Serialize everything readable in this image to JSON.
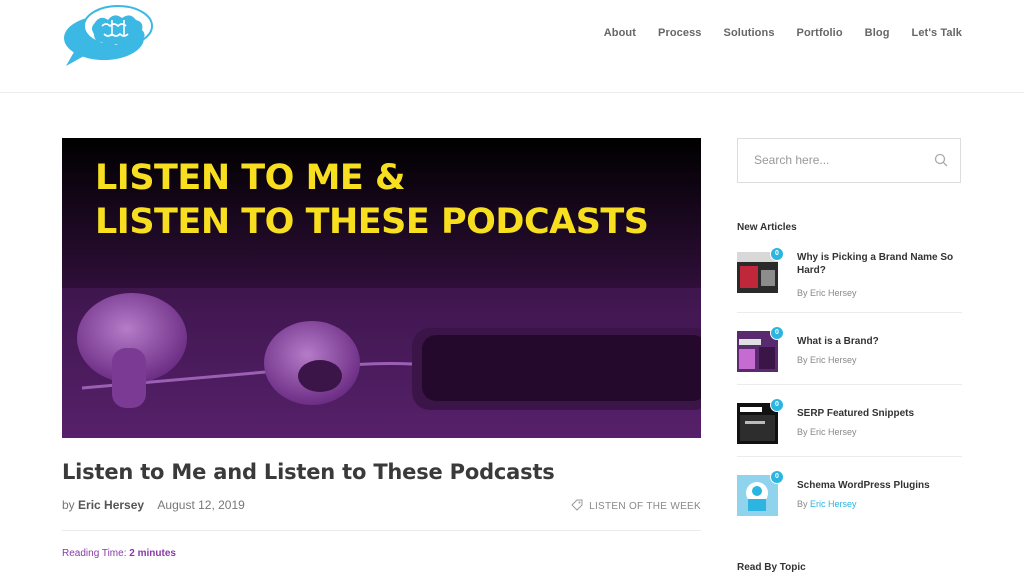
{
  "nav": {
    "items": [
      "About",
      "Process",
      "Solutions",
      "Portfolio",
      "Blog",
      "Let's Talk"
    ]
  },
  "hero": {
    "line1": "LISTEN TO ME &",
    "line2": "LISTEN TO THESE PODCASTS"
  },
  "post": {
    "title": "Listen to Me and Listen to These Podcasts",
    "by_label": "by",
    "author": "Eric Hersey",
    "date": "August 12, 2019",
    "category": "LISTEN OF THE WEEK",
    "reading_label": "Reading Time:",
    "reading_value": "2 minutes"
  },
  "search": {
    "placeholder": "Search here..."
  },
  "sidebar": {
    "new_articles_heading": "New Articles",
    "read_by_topic_heading": "Read By Topic",
    "articles": [
      {
        "title": "Why is Picking a Brand Name So Hard?",
        "by_label": "By",
        "author": "Eric Hersey",
        "count": "0"
      },
      {
        "title": "What is a Brand?",
        "by_label": "By",
        "author": "Eric Hersey",
        "count": "0"
      },
      {
        "title": "SERP Featured Snippets",
        "by_label": "By",
        "author": "Eric Hersey",
        "count": "0"
      },
      {
        "title": "Schema WordPress Plugins",
        "by_label": "By",
        "author": "Eric Hersey",
        "count": "0"
      }
    ]
  },
  "colors": {
    "accent_purple": "#8a3aa8",
    "accent_blue": "#2bb5e0",
    "hero_yellow": "#f7df20"
  }
}
